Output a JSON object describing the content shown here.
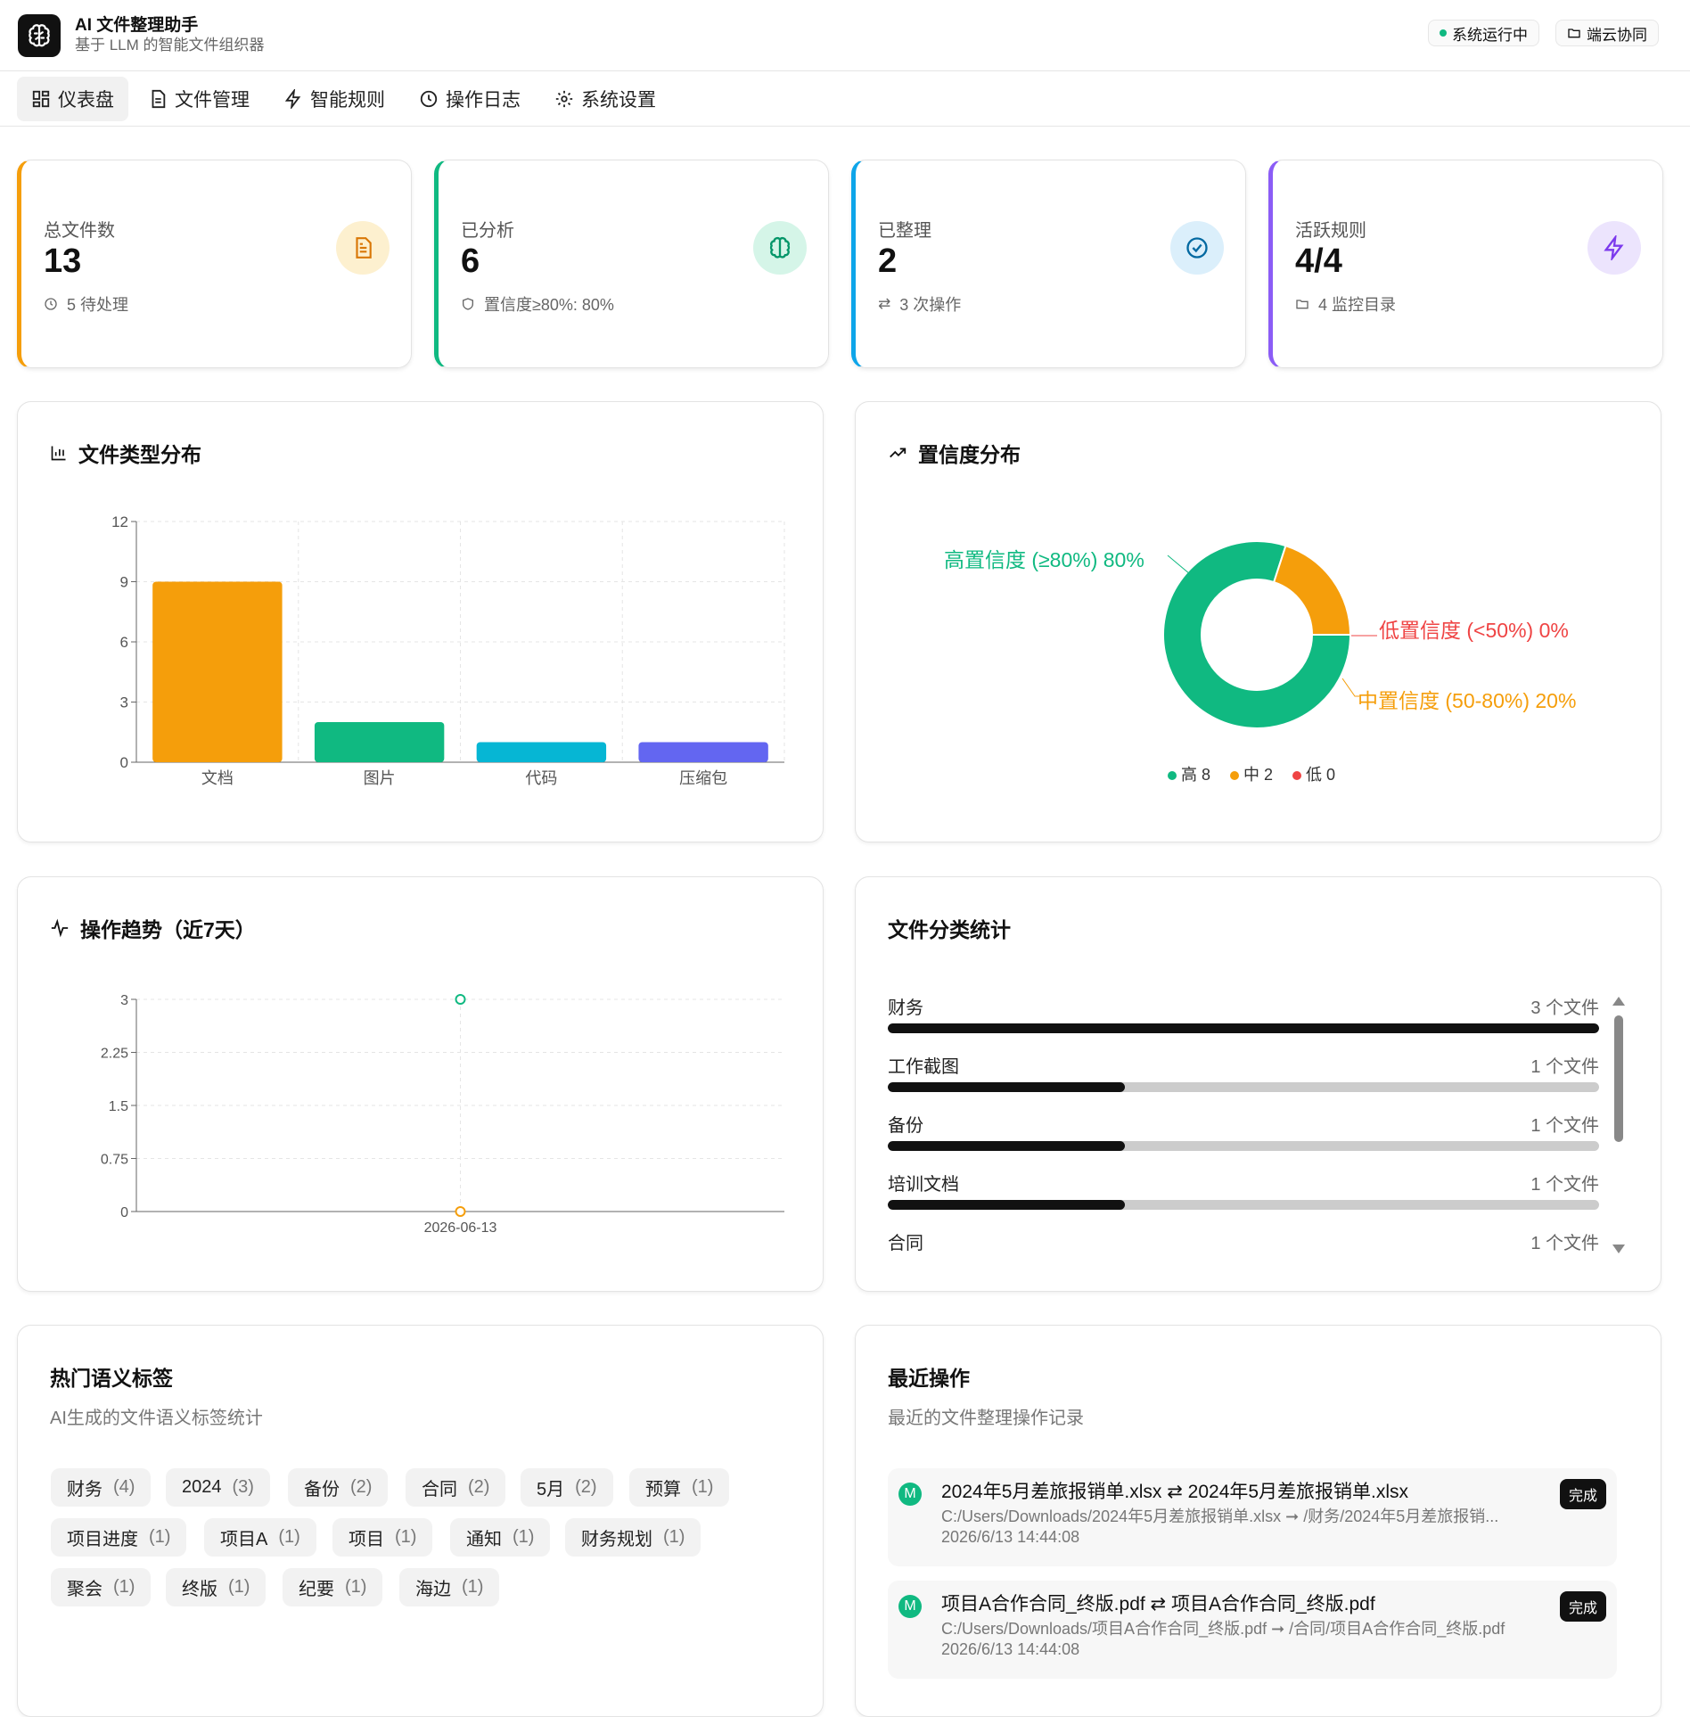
{
  "app": {
    "title": "AI 文件整理助手",
    "subtitle": "基于 LLM 的智能文件组织器",
    "status": "系统运行中",
    "sync": "端云协同"
  },
  "nav": [
    "仪表盘",
    "文件管理",
    "智能规则",
    "操作日志",
    "系统设置"
  ],
  "stats": [
    {
      "label": "总文件数",
      "value": "13",
      "foot": "5 待处理",
      "color": "#f59e0b"
    },
    {
      "label": "已分析",
      "value": "6",
      "foot": "置信度≥80%: 80%",
      "color": "#10b981"
    },
    {
      "label": "已整理",
      "value": "2",
      "foot": "3 次操作",
      "color": "#0ea5e9"
    },
    {
      "label": "活跃规则",
      "value": "4/4",
      "foot": "4 监控目录",
      "color": "#8b5cf6"
    }
  ],
  "type_dist": {
    "title": "文件类型分布"
  },
  "confidence": {
    "title": "置信度分布",
    "labels": {
      "high": "高置信度 (≥80%) 80%",
      "low": "低置信度 (<50%) 0%",
      "mid": "中置信度 (50-80%) 20%"
    },
    "legend": [
      "高 8",
      "中 2",
      "低 0"
    ]
  },
  "trend": {
    "title": "操作趋势（近7天）"
  },
  "categories": {
    "title": "文件分类统计",
    "items": [
      {
        "name": "财务",
        "count": "3 个文件",
        "ratio": 1.0
      },
      {
        "name": "工作截图",
        "count": "1 个文件",
        "ratio": 0.333
      },
      {
        "name": "备份",
        "count": "1 个文件",
        "ratio": 0.333
      },
      {
        "name": "培训文档",
        "count": "1 个文件",
        "ratio": 0.333
      },
      {
        "name": "合同",
        "count": "1 个文件",
        "ratio": 0.333
      }
    ]
  },
  "tags": {
    "title": "热门语义标签",
    "subtitle": "AI生成的文件语义标签统计",
    "items": [
      {
        "name": "财务",
        "count": "(4)"
      },
      {
        "name": "2024",
        "count": "(3)"
      },
      {
        "name": "备份",
        "count": "(2)"
      },
      {
        "name": "合同",
        "count": "(2)"
      },
      {
        "name": "5月",
        "count": "(2)"
      },
      {
        "name": "预算",
        "count": "(1)"
      },
      {
        "name": "项目进度",
        "count": "(1)"
      },
      {
        "name": "项目A",
        "count": "(1)"
      },
      {
        "name": "项目",
        "count": "(1)"
      },
      {
        "name": "通知",
        "count": "(1)"
      },
      {
        "name": "财务规划",
        "count": "(1)"
      },
      {
        "name": "聚会",
        "count": "(1)"
      },
      {
        "name": "终版",
        "count": "(1)"
      },
      {
        "name": "纪要",
        "count": "(1)"
      },
      {
        "name": "海边",
        "count": "(1)"
      }
    ]
  },
  "recent": {
    "title": "最近操作",
    "subtitle": "最近的文件整理操作记录",
    "items": [
      {
        "badge": "M",
        "title": "2024年5月差旅报销单.xlsx ⇄ 2024年5月差旅报销单.xlsx",
        "path": "C:/Users/Downloads/2024年5月差旅报销单.xlsx ➞ /财务/2024年5月差旅报销...",
        "time": "2026/6/13 14:44:08",
        "status": "完成"
      },
      {
        "badge": "M",
        "title": "项目A合作合同_终版.pdf ⇄ 项目A合作合同_终版.pdf",
        "path": "C:/Users/Downloads/项目A合作合同_终版.pdf ➞ /合同/项目A合作合同_终版.pdf",
        "time": "2026/6/13 14:44:08",
        "status": "完成"
      }
    ]
  },
  "chart_data": [
    {
      "type": "bar",
      "title": "文件类型分布",
      "categories": [
        "文档",
        "图片",
        "代码",
        "压缩包"
      ],
      "values": [
        9,
        2,
        1,
        1
      ],
      "colors": [
        "#f59e0b",
        "#10b981",
        "#06b6d4",
        "#6366f1"
      ],
      "ylim": [
        0,
        12
      ],
      "yticks": [
        "0",
        "3",
        "6",
        "9",
        "12"
      ],
      "grid": true
    },
    {
      "type": "pie",
      "title": "置信度分布",
      "categories": [
        "高",
        "中",
        "低"
      ],
      "values": [
        8,
        2,
        0
      ],
      "colors": [
        "#10b981",
        "#f59e0b",
        "#ef4444"
      ]
    },
    {
      "type": "line",
      "title": "操作趋势（近7天）",
      "x": [
        "2026-06-13"
      ],
      "series": [
        {
          "values": [
            3
          ],
          "color": "#10b981"
        },
        {
          "values": [
            0
          ],
          "color": "#f59e0b"
        }
      ],
      "ylim": [
        0,
        3
      ],
      "yticks": [
        "0",
        "0.75",
        "1.5",
        "2.25",
        "3"
      ],
      "grid": true
    }
  ]
}
